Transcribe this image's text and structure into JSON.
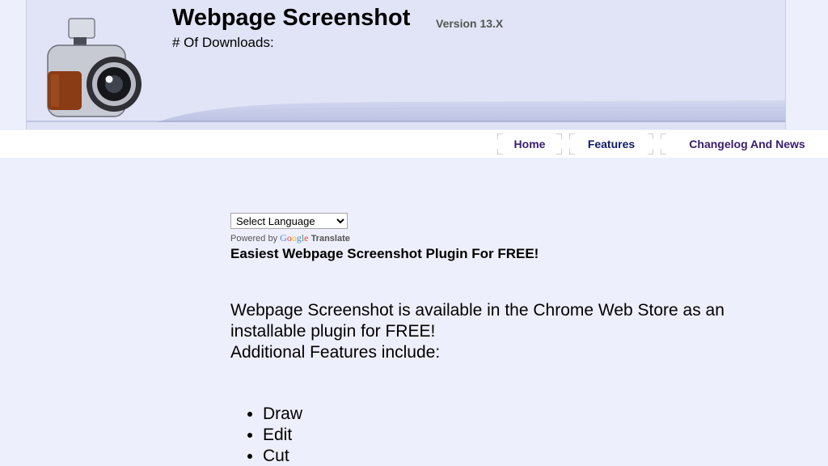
{
  "header": {
    "title": "Webpage Screenshot",
    "version": "Version 13.X",
    "downloads_label": "# Of Downloads:"
  },
  "logo": {
    "icon": "camera-icon"
  },
  "nav": {
    "items": [
      {
        "label": "Home"
      },
      {
        "label": "Features"
      },
      {
        "label": "Changelog And News"
      }
    ]
  },
  "translate": {
    "select_value": "Select Language",
    "powered_by": "Powered by",
    "google_letters": [
      "G",
      "o",
      "o",
      "g",
      "l",
      "e"
    ],
    "translate_label": "Translate"
  },
  "main": {
    "tagline": "Easiest Webpage Screenshot Plugin For FREE!",
    "intro_line1": "Webpage Screenshot is available in the Chrome Web Store as an",
    "intro_line2": "installable plugin for FREE!",
    "intro_line3": "Additional Features include:",
    "features": [
      "Draw",
      "Edit",
      "Cut"
    ]
  },
  "colors": {
    "page_background": "#eeeffc",
    "header_background": "#e1e4f6",
    "nav_link": "#3a1d6e",
    "nav_link_active": "#0f1a66"
  }
}
